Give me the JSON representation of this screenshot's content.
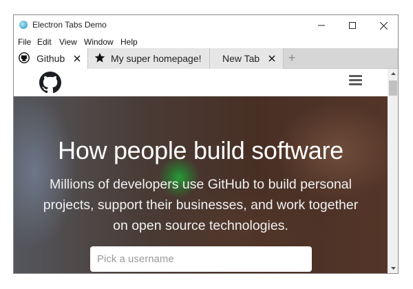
{
  "window": {
    "title": "Electron Tabs Demo",
    "app_icon": "electron-atom-icon"
  },
  "menu": {
    "items": [
      "File",
      "Edit",
      "View",
      "Window",
      "Help"
    ]
  },
  "tabs": [
    {
      "label": "Github",
      "icon": "github-icon",
      "active": true,
      "closable": true
    },
    {
      "label": "My super homepage!",
      "icon": "star-icon",
      "active": false,
      "closable": false
    },
    {
      "label": "New Tab",
      "icon": "",
      "active": false,
      "closable": true
    }
  ],
  "new_tab_label": "+",
  "page": {
    "hero_title": "How people build software",
    "hero_subtitle_lines": [
      "Millions of developers use GitHub to build personal",
      "projects, support their businesses, and work together",
      "on open source technologies."
    ],
    "username_placeholder": "Pick a username"
  },
  "colors": {
    "tabbar_bg": "#d6d6d6",
    "active_tab_bg": "#ffffff",
    "hero_text": "#ffffff"
  }
}
